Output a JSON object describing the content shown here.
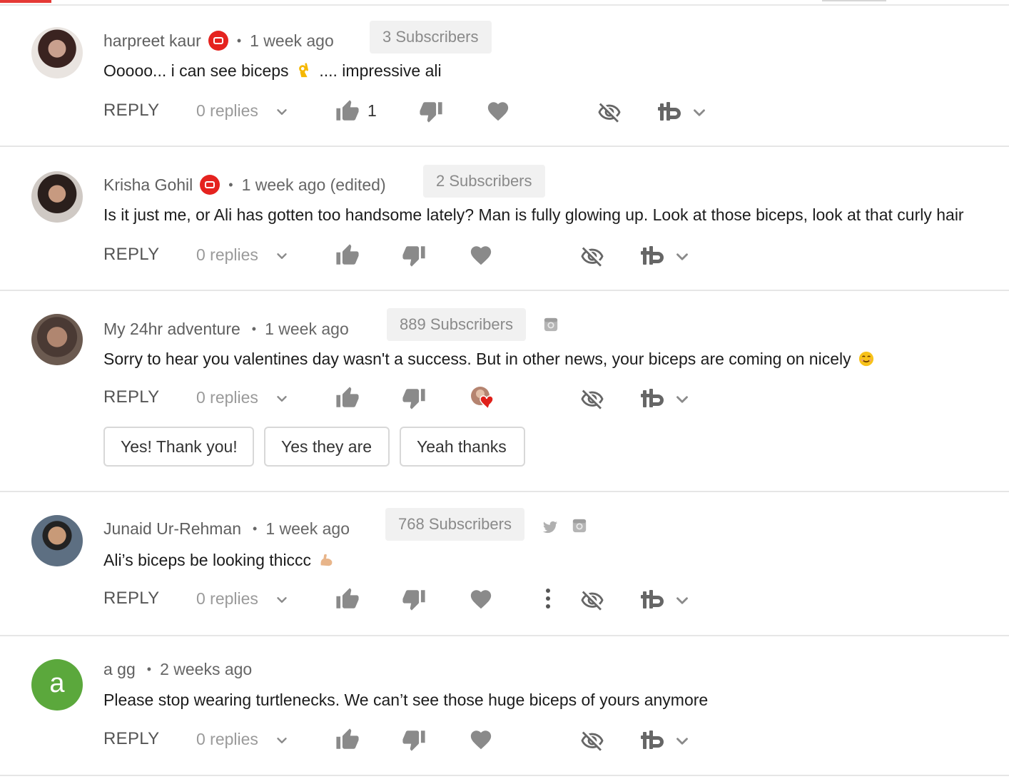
{
  "reply_label": "REPLY",
  "colors": {
    "badge_red": "#e5231f",
    "icon_grey": "#8a8a8a",
    "separator": "#e6e6e6",
    "avatar_green": "#5ba83c"
  },
  "comments": [
    {
      "author": "harpreet kaur",
      "has_youtube_badge": true,
      "time": "1 week ago",
      "subscribers": "3 Subscribers",
      "text_before_emoji": "Ooooo... i can see biceps",
      "emoji": "ok-hand-emoji",
      "text_after_emoji": ".... impressive ali",
      "replies": "0 replies",
      "like_count": "1"
    },
    {
      "author": "Krisha Gohil",
      "has_youtube_badge": true,
      "time": "1 week ago (edited)",
      "subscribers": "2 Subscribers",
      "text": "Is it just me, or Ali has gotten too handsome lately? Man is fully glowing up. Look at those biceps, look at that curly hair",
      "replies": "0 replies"
    },
    {
      "author": "My 24hr adventure",
      "time": "1 week ago",
      "subscribers": "889 Subscribers",
      "social": [
        "instagram-icon"
      ],
      "text": "Sorry to hear you valentines day wasn't a success. But in other news, your biceps are coming on nicely",
      "emoji": "smiling-face-emoji",
      "replies": "0 replies",
      "hearted_by_creator": true,
      "smart_replies": [
        "Yes! Thank you!",
        "Yes they are",
        "Yeah thanks"
      ]
    },
    {
      "author": "Junaid Ur-Rehman",
      "time": "1 week ago",
      "subscribers": "768 Subscribers",
      "social": [
        "twitter-icon",
        "instagram-icon"
      ],
      "text": "Ali’s biceps be looking thiccc",
      "emoji": "flexed-biceps-emoji",
      "replies": "0 replies",
      "has_more_menu": true
    },
    {
      "author": "a gg",
      "avatar_letter": "a",
      "time": "2 weeks ago",
      "text": "Please stop wearing turtlenecks. We can’t see those huge biceps of yours anymore",
      "replies": "0 replies"
    }
  ]
}
